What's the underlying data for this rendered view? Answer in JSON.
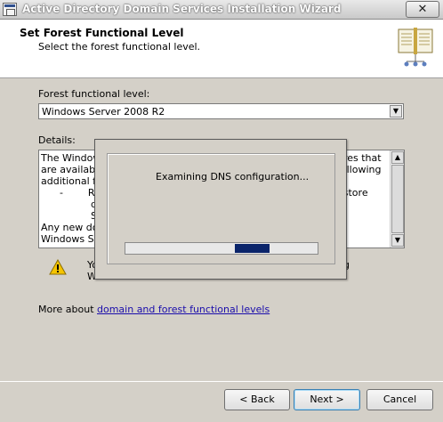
{
  "window": {
    "title": "Active Directory Domain Services Installation Wizard",
    "close_label": "✕"
  },
  "header": {
    "title": "Set Forest Functional Level",
    "subtitle": "Select the forest functional level."
  },
  "form": {
    "level_label": "Forest functional level:",
    "level_value": "Windows Server 2008 R2",
    "details_label": "Details:",
    "details_lines": [
      "The Windows",
      "are available i",
      "additional feat",
      "      -        Rec",
      "                dele",
      "                Serv",
      "Any new dom",
      "Windows Serv"
    ],
    "details_right_lines": [
      "ures that",
      "following",
      "",
      "estore",
      "",
      "",
      "e",
      ""
    ],
    "warning_lines": [
      "Yo",
      "W"
    ],
    "warning_right": "g",
    "more_prefix": "More about ",
    "more_link": "domain and forest functional levels"
  },
  "dialog": {
    "message": "Examining DNS configuration...",
    "progress_start": 0.57,
    "progress_end": 0.75
  },
  "buttons": {
    "back": "< Back",
    "next": "Next >",
    "cancel": "Cancel"
  }
}
